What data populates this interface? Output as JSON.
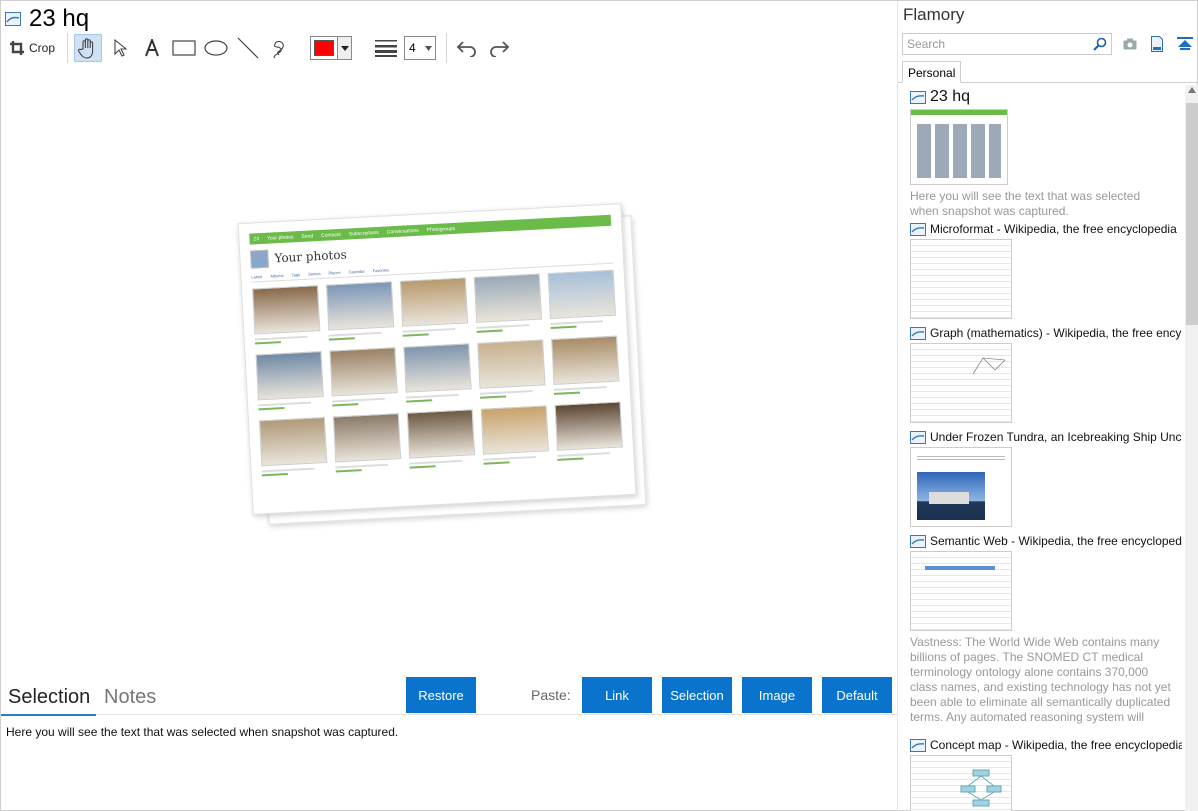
{
  "window": {
    "title": "23 hq"
  },
  "toolbar": {
    "crop_label": "Crop",
    "line_width_value": "4",
    "stroke_color": "#ff0000",
    "tools": [
      "hand-tool",
      "pointer-tool",
      "text-tool",
      "rectangle-tool",
      "ellipse-tool",
      "line-tool",
      "freehand-tool"
    ]
  },
  "preview": {
    "page_title": "Your photos",
    "nav_items": [
      "23",
      "Your photos",
      "Send",
      "Contacts",
      "Subscriptions",
      "Conversations",
      "Photogroups"
    ],
    "tabs": [
      "Latest",
      "Albums",
      "Tags",
      "Stories",
      "Places",
      "Calendar",
      "Favorites"
    ]
  },
  "notes": {
    "tab_selection": "Selection",
    "tab_notes": "Notes",
    "restore_label": "Restore",
    "paste_label": "Paste:",
    "paste_buttons": [
      "Link",
      "Selection",
      "Image",
      "Default"
    ],
    "selection_text": "Here you will see the text that was selected when snapshot was captured."
  },
  "sidebar": {
    "app_name": "Flamory",
    "search_placeholder": "Search",
    "tab_personal": "Personal",
    "accent_color": "#0a73cc",
    "items": [
      {
        "title": "23 hq",
        "desc": "Here you will see the text that was selected when snapshot was captured."
      },
      {
        "title": "Microformat - Wikipedia, the free encyclopedia"
      },
      {
        "title": "Graph (mathematics) - Wikipedia, the free ency"
      },
      {
        "title": "Under Frozen Tundra, an Icebreaking Ship Unco"
      },
      {
        "title": "Semantic Web - Wikipedia, the free encycloped",
        "desc": "Vastness: The World Wide Web contains many billions of pages. The SNOMED CT medical terminology ontology alone contains 370,000 class names, and existing technology has not yet been able to eliminate all semantically duplicated terms. Any automated reasoning system will have to deal with truly huge inputs."
      },
      {
        "title": "Concept map - Wikipedia, the free encyclopedia"
      }
    ]
  }
}
